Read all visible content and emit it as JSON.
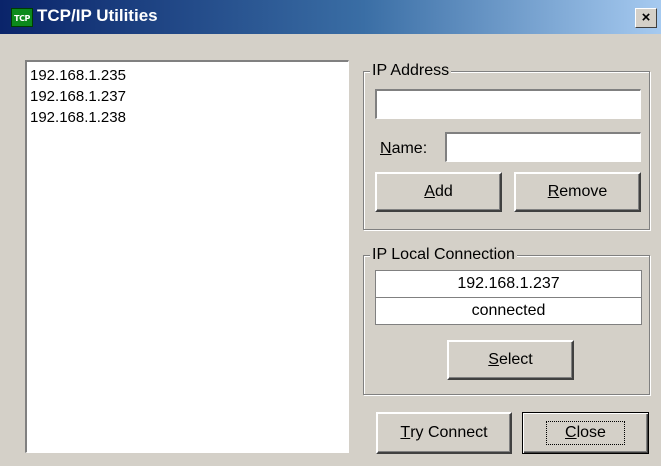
{
  "window": {
    "icon_text": "TCP",
    "title": "TCP/IP Utilities",
    "close_glyph": "×"
  },
  "ip_list": [
    "192.168.1.235",
    "192.168.1.237",
    "192.168.1.238"
  ],
  "ip_address_group": {
    "legend": "IP Address",
    "ip_value": "",
    "name_label_mnemonic": "N",
    "name_label_rest": "ame:",
    "name_value": "",
    "add_mnemonic": "A",
    "add_rest": "dd",
    "remove_mnemonic": "R",
    "remove_rest": "emove"
  },
  "local_connection_group": {
    "legend": "IP Local Connection",
    "ip": "192.168.1.237",
    "status": "connected",
    "select_mnemonic": "S",
    "select_rest": "elect"
  },
  "footer": {
    "try_connect_mnemonic": "T",
    "try_connect_rest": "ry Connect",
    "close_mnemonic": "C",
    "close_rest": "lose"
  }
}
